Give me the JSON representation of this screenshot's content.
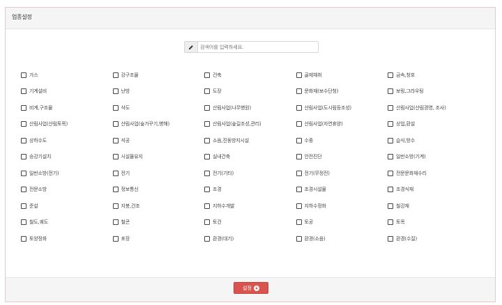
{
  "panel": {
    "title": "업종설정"
  },
  "search": {
    "placeholder": "검색어를 입력하세요."
  },
  "categories": [
    "가스",
    "강구조물",
    "건축",
    "골재채취",
    "금속,창호",
    "기계설비",
    "난방",
    "도장",
    "문화재(보수단청)",
    "보링,그라우팅",
    "비계,구조물",
    "삭도",
    "산림사업(나무병원)",
    "산림사업(도시림등조성)",
    "산림사업(산림경영, 조사)",
    "산림사업(산림토목)",
    "산림사업(숲가꾸기,병해)",
    "산림사업(숲길조성,관리)",
    "산림사업(자연휴양)",
    "상업,환설",
    "상하수도",
    "석공",
    "소음,진동방지시설",
    "수중",
    "습식,방수",
    "승강기설치",
    "시설물유지",
    "실내건축",
    "안전진단",
    "일반소방(기계)",
    "일반소방(전기)",
    "전기",
    "전기(기타)",
    "전기(무정전)",
    "전문문화재수리",
    "전문소방",
    "정보통신",
    "조경",
    "조경시설물",
    "조경식재",
    "준설",
    "지붕,건조",
    "지하수개발",
    "지하수정화",
    "철강재",
    "철도,궤도",
    "철콘",
    "토건",
    "토공",
    "토목",
    "토양정화",
    "포장",
    "환경(대기)",
    "환경(소음)",
    "환경(수질)"
  ],
  "footer": {
    "apply_label": "설정"
  },
  "icons": {
    "search": "pencil-icon",
    "apply": "download-circle-icon"
  },
  "colors": {
    "accent": "#d9534f",
    "panel_border": "#e7c9c9"
  }
}
